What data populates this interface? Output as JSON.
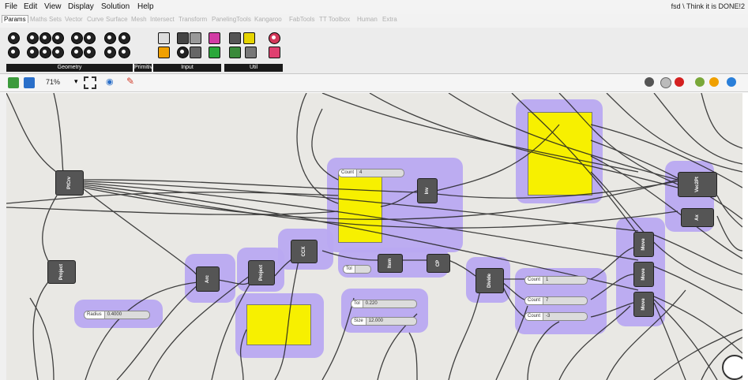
{
  "menubar": {
    "items": [
      "File",
      "Edit",
      "View",
      "Display",
      "Solution",
      "Help"
    ],
    "right_text": "fsd \\ Think it is DONE!2"
  },
  "tabs": [
    "Params",
    "Maths",
    "Sets",
    "Vector",
    "Curve",
    "Surface",
    "Mesh",
    "Intersect",
    "Transform",
    "PanelingTools",
    "Kangaroo",
    "FabTools",
    "TT Toolbox",
    "Human",
    "Extra"
  ],
  "ribbon": {
    "groups": [
      "Geometry",
      "Primitive",
      "Input",
      "Util"
    ]
  },
  "toolbar": {
    "zoom": "71%"
  },
  "components": {
    "ptcrv": "PtCrv",
    "project1": "Project",
    "project2": "Project",
    "arc": "Arc",
    "ccx": "CCX",
    "item": "Item",
    "inv": "Inv",
    "cp": "CP",
    "divide": "Divide",
    "move1": "Move",
    "move2": "Move",
    "move3": "Move",
    "vec2pt": "Vec2Pt",
    "ax": "Ax"
  },
  "sliders": {
    "s1": {
      "name": "Count",
      "value": "4"
    },
    "s2": {
      "name": "Radius",
      "value": "0.4000"
    },
    "s3": {
      "name": "Tol",
      "value": "0.220"
    },
    "s4": {
      "name": "Size",
      "value": "12.000"
    },
    "s5": {
      "name": "Count",
      "value": "1"
    },
    "s6": {
      "name": "Count",
      "value": "7"
    },
    "s7": {
      "name": "Count",
      "value": "-3"
    },
    "s8": {
      "name": "Tol",
      "value": ""
    }
  }
}
